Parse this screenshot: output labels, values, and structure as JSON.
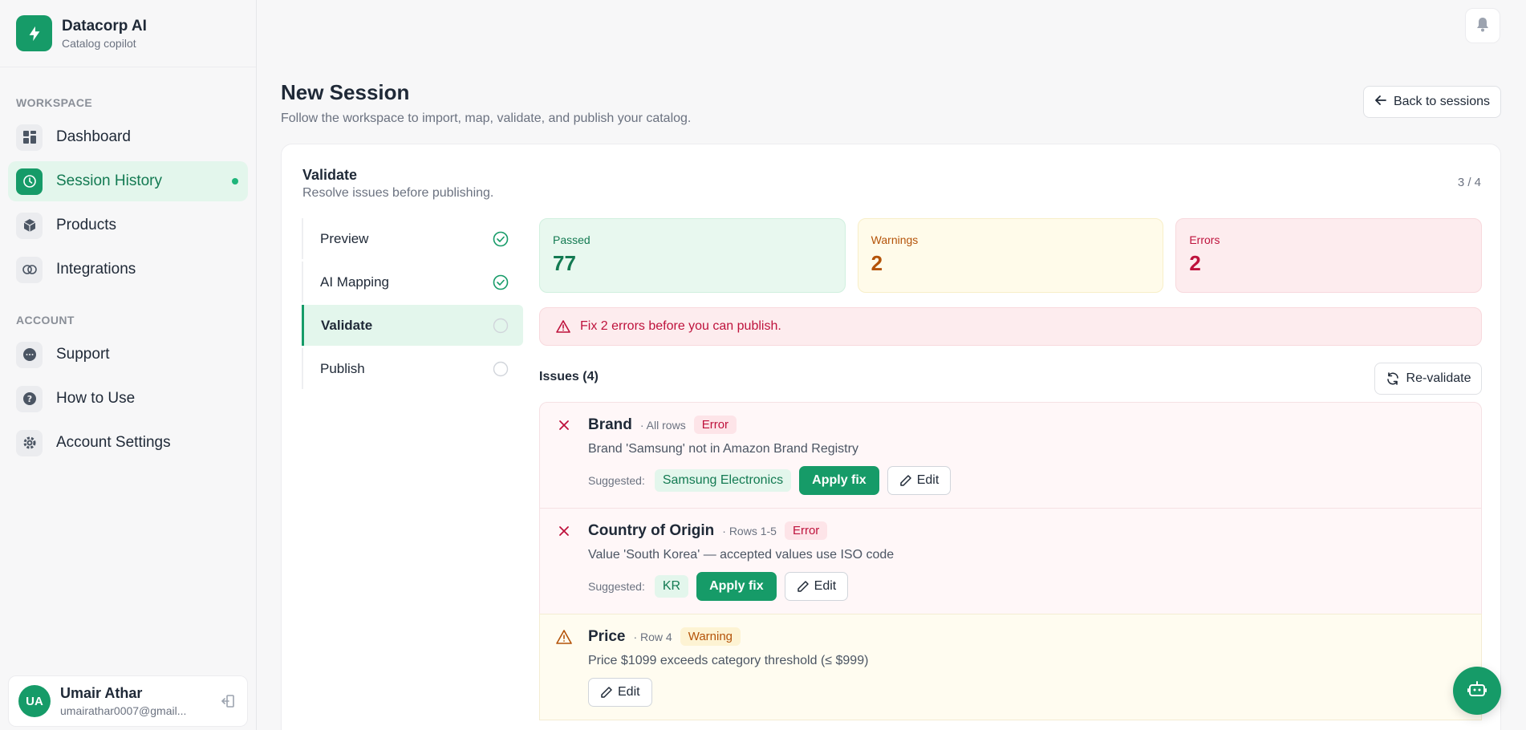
{
  "brand": {
    "name": "Datacorp AI",
    "subtitle": "Catalog copilot"
  },
  "sidebar": {
    "workspace_label": "WORKSPACE",
    "workspace_items": [
      {
        "label": "Dashboard",
        "icon": "dashboard-icon"
      },
      {
        "label": "Session History",
        "icon": "clock-icon",
        "active": true
      },
      {
        "label": "Products",
        "icon": "box-icon"
      },
      {
        "label": "Integrations",
        "icon": "link-icon"
      }
    ],
    "account_label": "ACCOUNT",
    "account_items": [
      {
        "label": "Support",
        "icon": "chat-icon"
      },
      {
        "label": "How to Use",
        "icon": "help-icon"
      },
      {
        "label": "Account Settings",
        "icon": "gear-icon"
      }
    ]
  },
  "user": {
    "initials": "UA",
    "name": "Umair Athar",
    "email": "umairathar0007@gmail..."
  },
  "header": {
    "title": "New Session",
    "subtitle": "Follow the workspace to import, map, validate, and publish your catalog.",
    "back_label": "Back to sessions"
  },
  "step_card": {
    "title": "Validate",
    "subtitle": "Resolve issues before publishing.",
    "counter": "3 / 4"
  },
  "steps": [
    {
      "label": "Preview",
      "status": "done"
    },
    {
      "label": "AI Mapping",
      "status": "done"
    },
    {
      "label": "Validate",
      "status": "active"
    },
    {
      "label": "Publish",
      "status": "pending"
    }
  ],
  "stats": {
    "passed": {
      "label": "Passed",
      "value": "77"
    },
    "warnings": {
      "label": "Warnings",
      "value": "2"
    },
    "errors": {
      "label": "Errors",
      "value": "2"
    }
  },
  "alert": {
    "text": "Fix 2 errors before you can publish."
  },
  "issues_header": {
    "title": "Issues (4)",
    "revalidate_label": "Re-validate"
  },
  "issues": [
    {
      "field": "Brand",
      "rows": "· All rows",
      "severity": "Error",
      "message": "Brand 'Samsung' not in Amazon Brand Registry",
      "suggested_label": "Suggested:",
      "suggested": "Samsung Electronics",
      "apply_label": "Apply fix",
      "edit_label": "Edit"
    },
    {
      "field": "Country of Origin",
      "rows": "· Rows 1-5",
      "severity": "Error",
      "message": "Value 'South Korea' — accepted values use ISO code",
      "suggested_label": "Suggested:",
      "suggested": "KR",
      "apply_label": "Apply fix",
      "edit_label": "Edit"
    },
    {
      "field": "Price",
      "rows": "· Row 4",
      "severity": "Warning",
      "message": "Price $1099 exceeds category threshold (≤ $999)",
      "edit_label": "Edit"
    }
  ],
  "colors": {
    "accent": "#169b68",
    "error": "#be123c",
    "warning": "#b45309"
  }
}
